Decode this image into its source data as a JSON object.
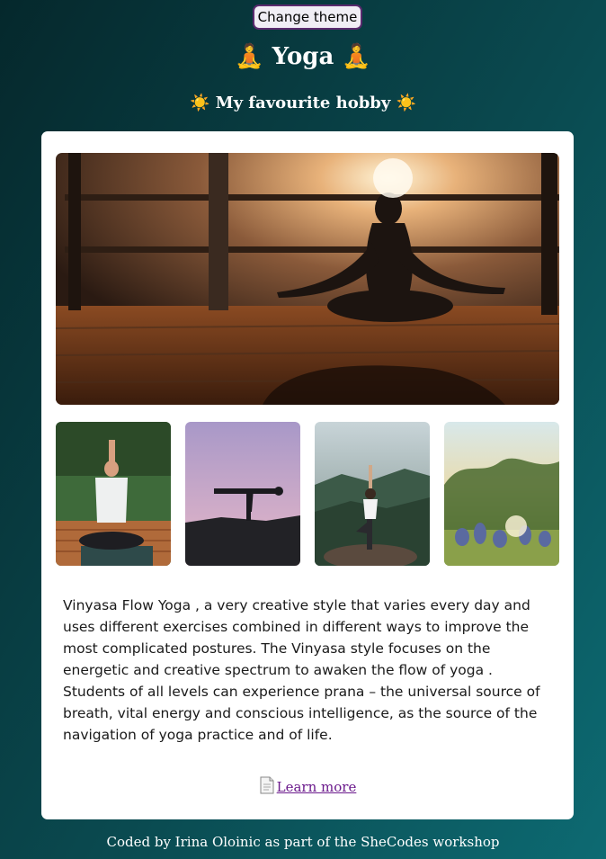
{
  "header": {
    "theme_button_label": "Change theme",
    "title_text": "Yoga",
    "title_emoji_left": "🧘",
    "title_emoji_right": "🧘",
    "subtitle_text": "My favourite hobby",
    "subtitle_emoji_left": "☀️",
    "subtitle_emoji_right": "☀️"
  },
  "card": {
    "description": "Vinyasa Flow Yoga , a very creative style that varies every day and uses different exercises combined in different ways to improve the most complicated postures. The Vinyasa style focuses on the energetic and creative spectrum to awaken the flow of yoga . Students of all levels can experience prana – the universal source of breath, vital energy and conscious intelligence, as the source of the navigation of yoga practice and of life.",
    "learn_more_label": "Learn more",
    "learn_more_icon": "document-icon"
  },
  "footer": {
    "text": "Coded by Irina Oloinic as part of the SheCodes workshop"
  },
  "colors": {
    "background_start": "#05282c",
    "background_end": "#0d6a72",
    "card_background": "#ffffff",
    "link": "#6b1a8c",
    "button_border": "#5a2a6e"
  }
}
